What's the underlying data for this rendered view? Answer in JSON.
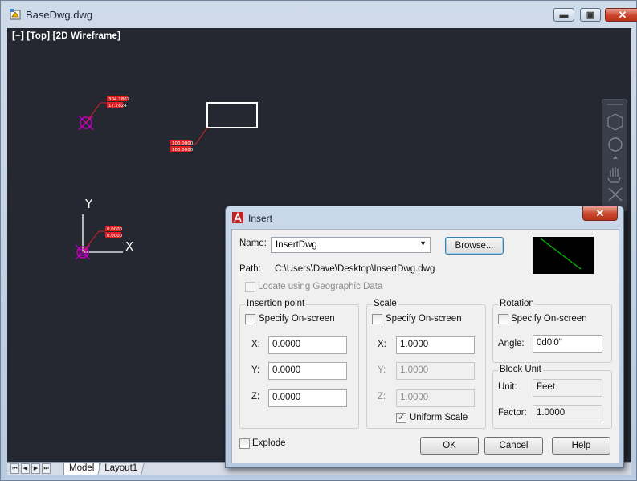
{
  "window": {
    "title": "BaseDwg.dwg",
    "minimize_glyph": "▬",
    "maximize_glyph": "▣",
    "close_glyph": "✕"
  },
  "viewport": {
    "label": "[−] [Top] [2D Wireframe]",
    "axis_y": "Y",
    "axis_x": "X",
    "annotations": [
      "304.1867",
      "17.7824",
      "100.0000",
      "100.0000",
      "0.0000",
      "0.0000"
    ]
  },
  "tabs": {
    "model": "Model",
    "layout1": "Layout1",
    "nav": [
      "⏮",
      "◀",
      "▶",
      "⏭"
    ]
  },
  "dialog": {
    "title": "Insert",
    "close_glyph": "✕",
    "name_label": "Name:",
    "name_value": "InsertDwg",
    "browse_label": "Browse...",
    "path_label": "Path:",
    "path_value": "C:\\Users\\Dave\\Desktop\\InsertDwg.dwg",
    "geo_label": "Locate using Geographic Data",
    "insertion": {
      "title": "Insertion point",
      "specify_label": "Specify On-screen",
      "x_label": "X:",
      "x_value": "0.0000",
      "y_label": "Y:",
      "y_value": "0.0000",
      "z_label": "Z:",
      "z_value": "0.0000"
    },
    "scale": {
      "title": "Scale",
      "specify_label": "Specify On-screen",
      "x_label": "X:",
      "x_value": "1.0000",
      "y_label": "Y:",
      "y_value": "1.0000",
      "z_label": "Z:",
      "z_value": "1.0000",
      "uniform_label": "Uniform Scale",
      "uniform_checked": "✓"
    },
    "rotation": {
      "title": "Rotation",
      "specify_label": "Specify On-screen",
      "angle_label": "Angle:",
      "angle_value": "0d0'0\""
    },
    "block_unit": {
      "title": "Block Unit",
      "unit_label": "Unit:",
      "unit_value": "Feet",
      "factor_label": "Factor:",
      "factor_value": "1.0000"
    },
    "explode_label": "Explode",
    "ok_label": "OK",
    "cancel_label": "Cancel",
    "help_label": "Help"
  },
  "colors": {
    "viewport_bg": "#252830",
    "marker": "#c000c0",
    "annotation": "#e02020",
    "preview_line": "#00c000"
  }
}
